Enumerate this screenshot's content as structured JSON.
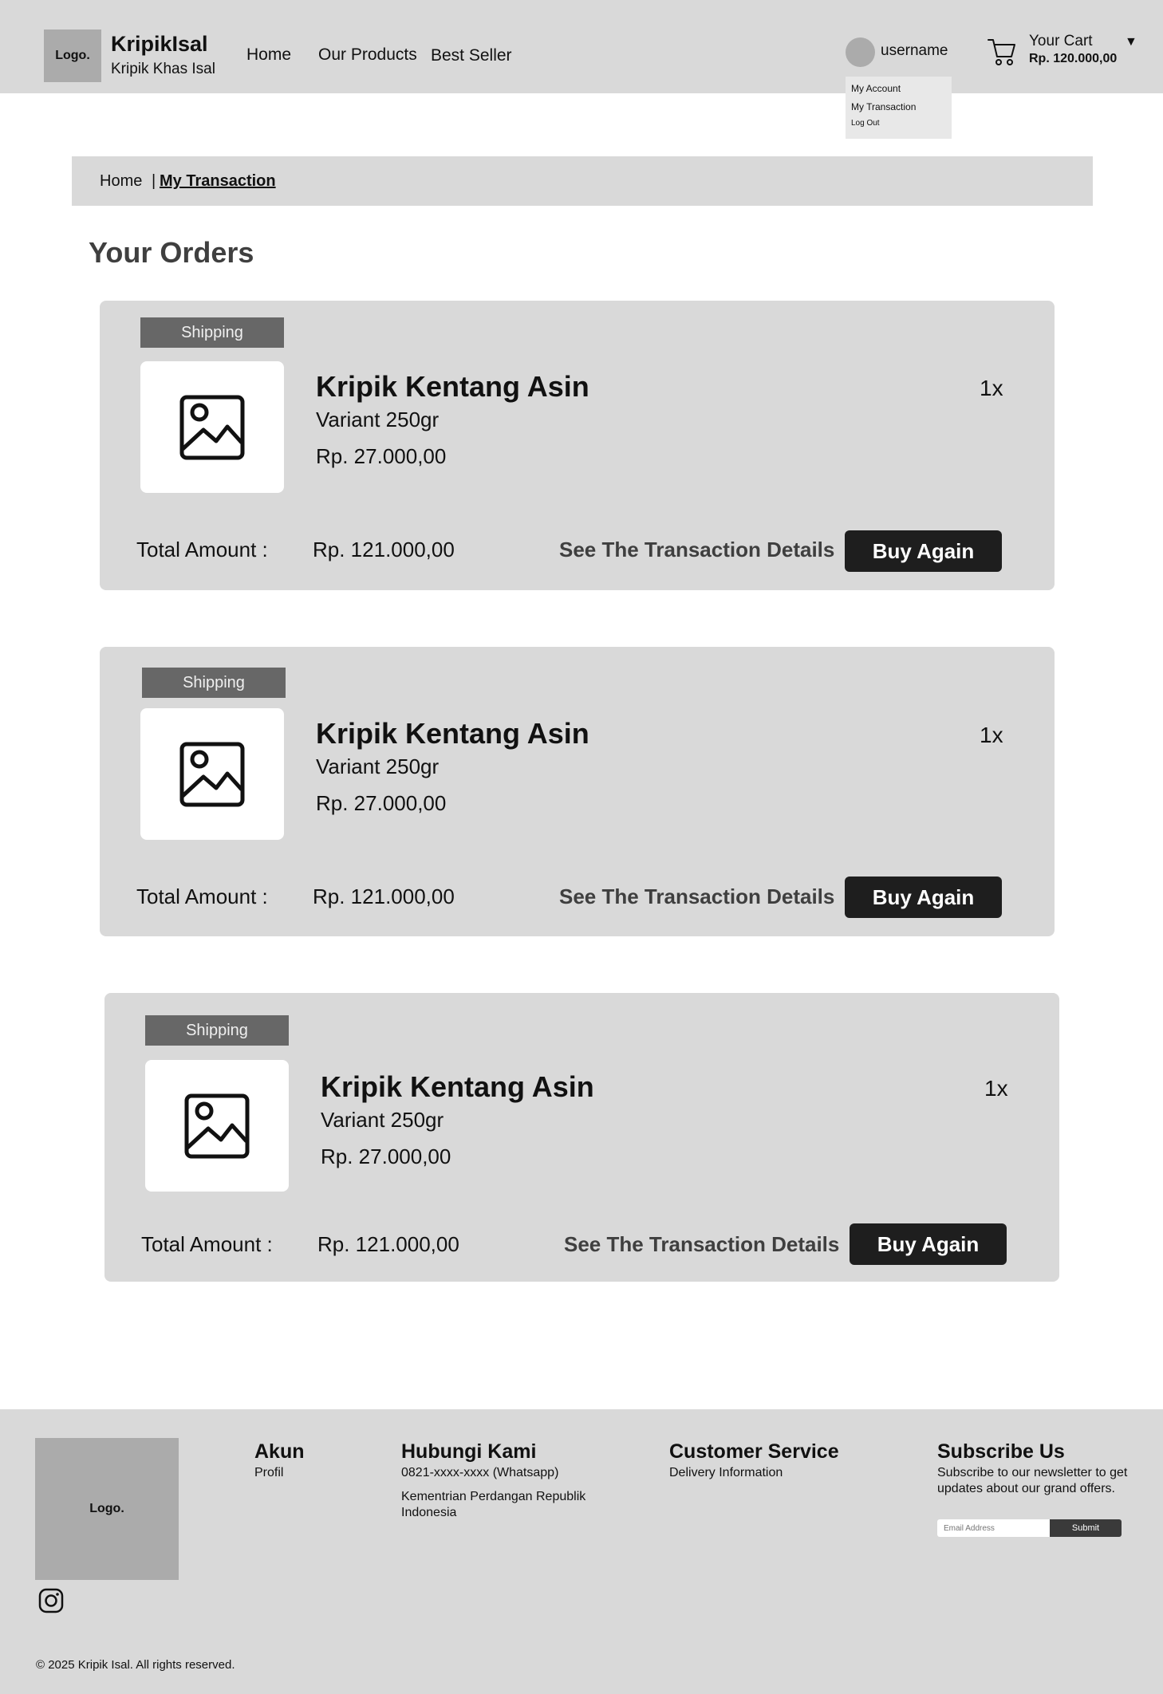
{
  "header": {
    "logo": "Logo.",
    "brand_name": "KripikIsal",
    "brand_tagline": "Kripik Khas Isal",
    "nav": [
      "Home",
      "Our Products",
      "Best Seller"
    ],
    "username": "username",
    "cart_title": "Your Cart",
    "cart_total": "Rp. 120.000,00",
    "icons": {
      "cart": "cart-icon",
      "caret": "caret-down-icon",
      "avatar": "avatar"
    }
  },
  "account_menu": {
    "items": [
      "My Account",
      "My Transaction",
      "Log Out"
    ]
  },
  "breadcrumb": {
    "home": "Home",
    "separator": "|",
    "current": "My Transaction"
  },
  "page_title": "Your Orders",
  "orders": [
    {
      "status": "Shipping",
      "product_name": "Kripik Kentang Asin",
      "variant": "Variant 250gr",
      "price": "Rp. 27.000,00",
      "quantity": "1x",
      "total_label": "Total Amount :",
      "total_value": "Rp. 121.000,00",
      "details_label": "See The Transaction Details",
      "buy_again_label": "Buy Again"
    },
    {
      "status": "Shipping",
      "product_name": "Kripik Kentang Asin",
      "variant": "Variant 250gr",
      "price": "Rp. 27.000,00",
      "quantity": "1x",
      "total_label": "Total Amount :",
      "total_value": "Rp. 121.000,00",
      "details_label": "See The Transaction Details",
      "buy_again_label": "Buy Again"
    },
    {
      "status": "Shipping",
      "product_name": "Kripik Kentang Asin",
      "variant": "Variant 250gr",
      "price": "Rp. 27.000,00",
      "quantity": "1x",
      "total_label": "Total Amount :",
      "total_value": "Rp. 121.000,00",
      "details_label": "See The Transaction Details",
      "buy_again_label": "Buy Again"
    }
  ],
  "footer": {
    "logo": "Logo.",
    "akun": {
      "title": "Akun",
      "items": [
        "Profil"
      ]
    },
    "hubungi": {
      "title": "Hubungi Kami",
      "phone": "0821-xxxx-xxxx (Whatsapp)",
      "address": "Kementrian Perdangan Republik Indonesia"
    },
    "customer_service": {
      "title": "Customer Service",
      "items": [
        "Delivery Information"
      ]
    },
    "subscribe": {
      "title": "Subscribe Us",
      "text": "Subscribe to our newsletter to get updates about our grand offers.",
      "email_placeholder": "Email Address",
      "submit_label": "Submit"
    },
    "copyright": "© 2025 Kripik Isal. All rights reserved.",
    "icons": {
      "social": "instagram-icon"
    }
  },
  "colors": {
    "panel_gray": "#d9d9d9",
    "badge_gray": "#676767",
    "button_dark": "#1e1e1e",
    "logo_gray": "#ababab"
  }
}
